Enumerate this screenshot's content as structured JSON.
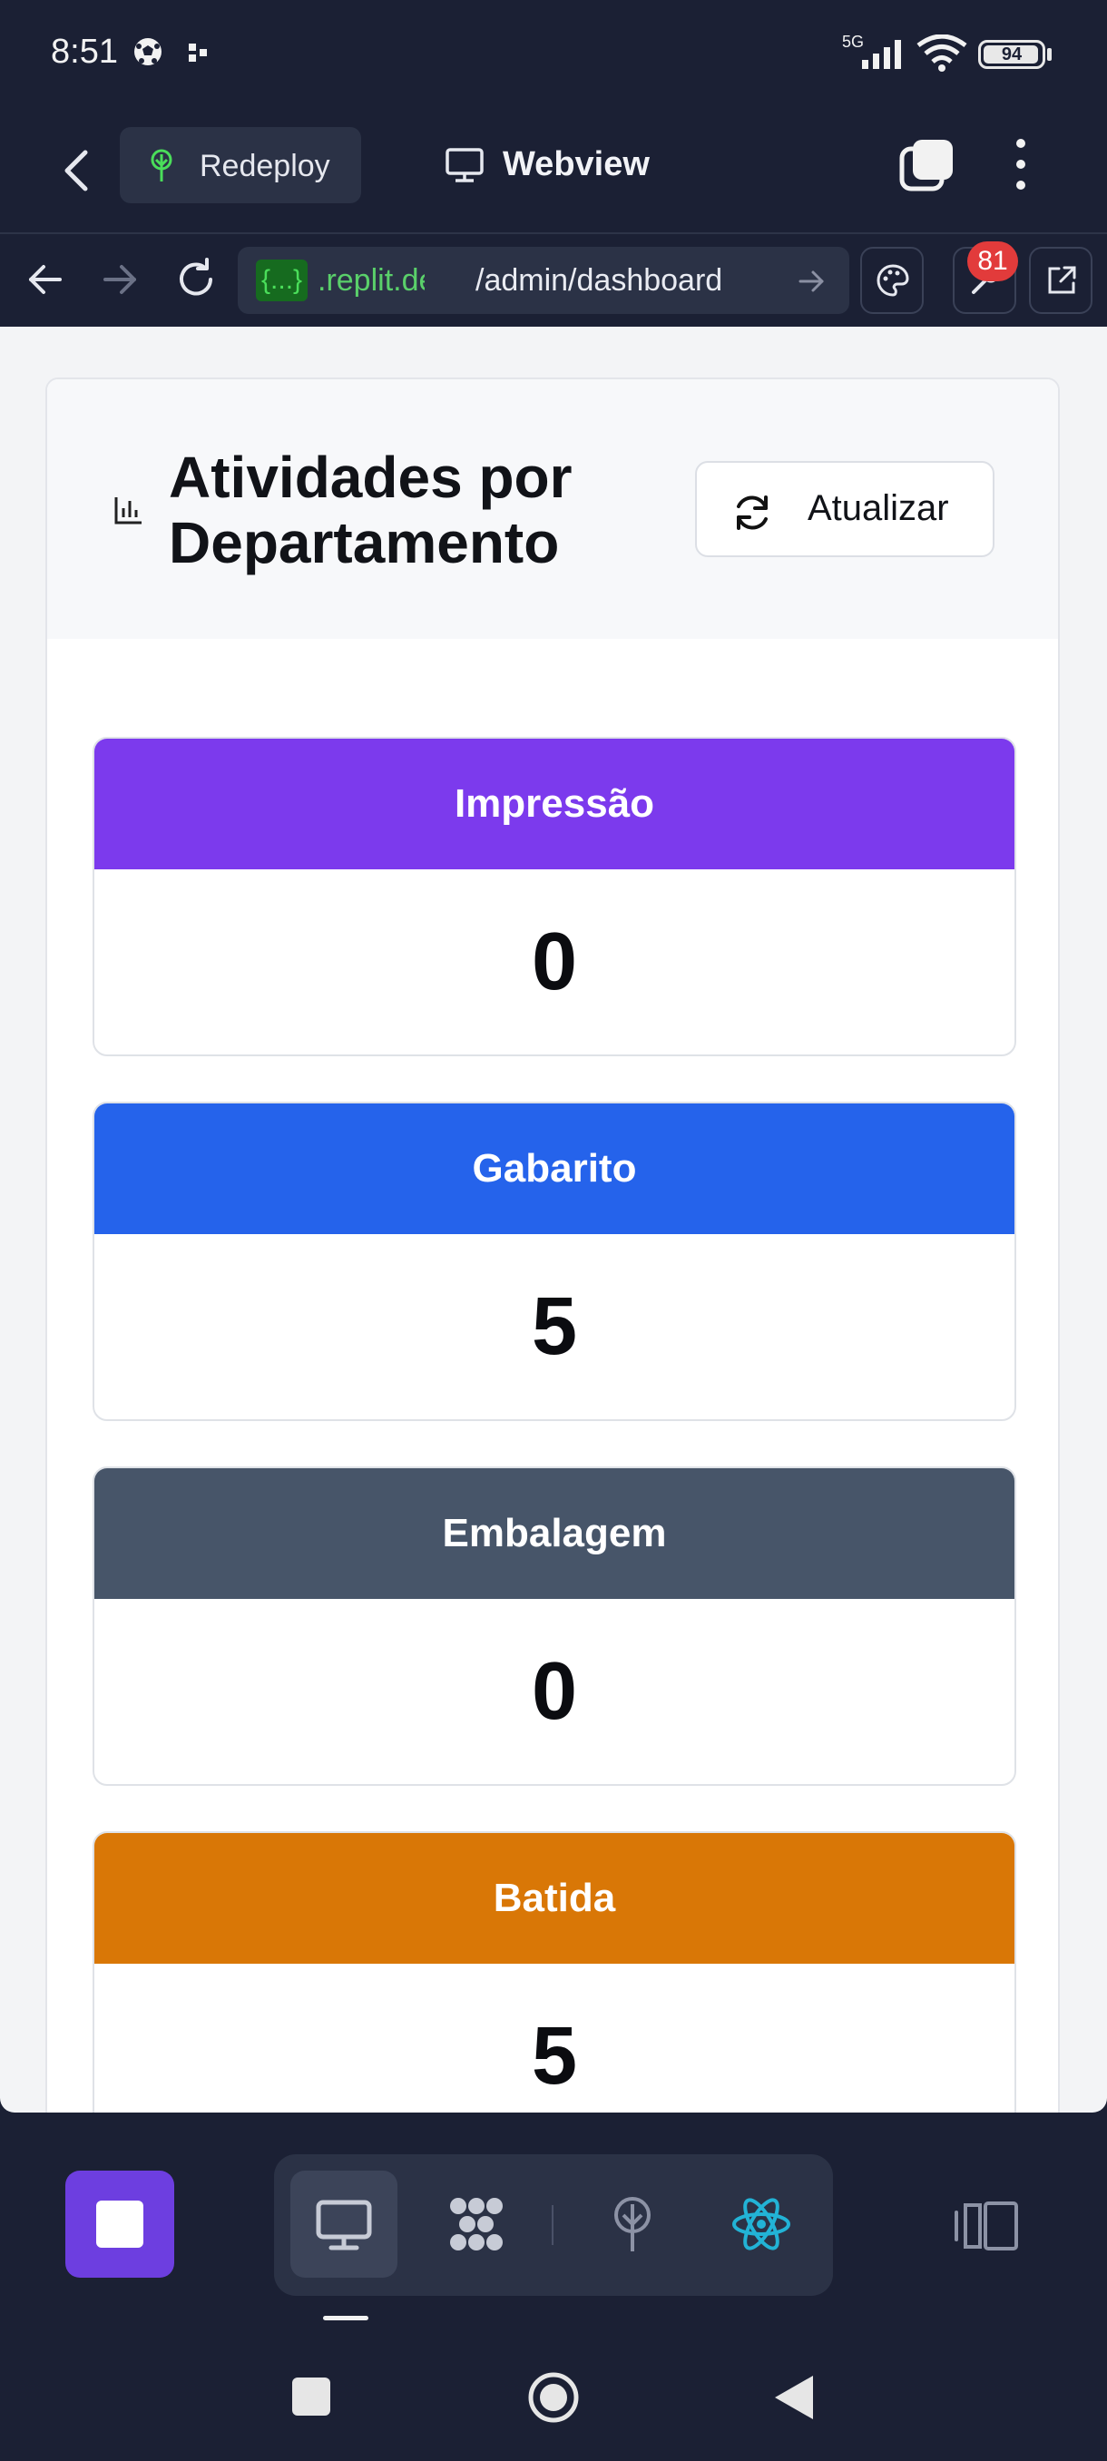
{
  "status_bar": {
    "time": "8:51",
    "network": "5G",
    "battery": "94"
  },
  "header": {
    "redeploy_label": "Redeploy",
    "title": "Webview"
  },
  "url_bar": {
    "badge": "{...}",
    "host": ".replit.de",
    "path": "/admin/dashboard",
    "notification_count": "81"
  },
  "dashboard": {
    "title": "Atividades por Departamento",
    "refresh_label": "Atualizar",
    "departments": [
      {
        "name": "Impressão",
        "count": "0",
        "color": "#7c3aed"
      },
      {
        "name": "Gabarito",
        "count": "5",
        "color": "#2563eb"
      },
      {
        "name": "Embalagem",
        "count": "0",
        "color": "#475569"
      },
      {
        "name": "Batida",
        "count": "5",
        "color": "#d97706"
      }
    ]
  },
  "colors": {
    "background": "#1b2034",
    "accent": "#6d3ee0",
    "react": "#22b3d6"
  },
  "icons": {
    "status": [
      "soccer-ball-icon",
      "dots-icon",
      "signal-icon",
      "wifi-icon",
      "battery-icon"
    ],
    "dock": [
      "stop-icon",
      "desktop-icon",
      "workflow-icon",
      "deploy-icon",
      "react-icon",
      "layout-icon"
    ]
  }
}
